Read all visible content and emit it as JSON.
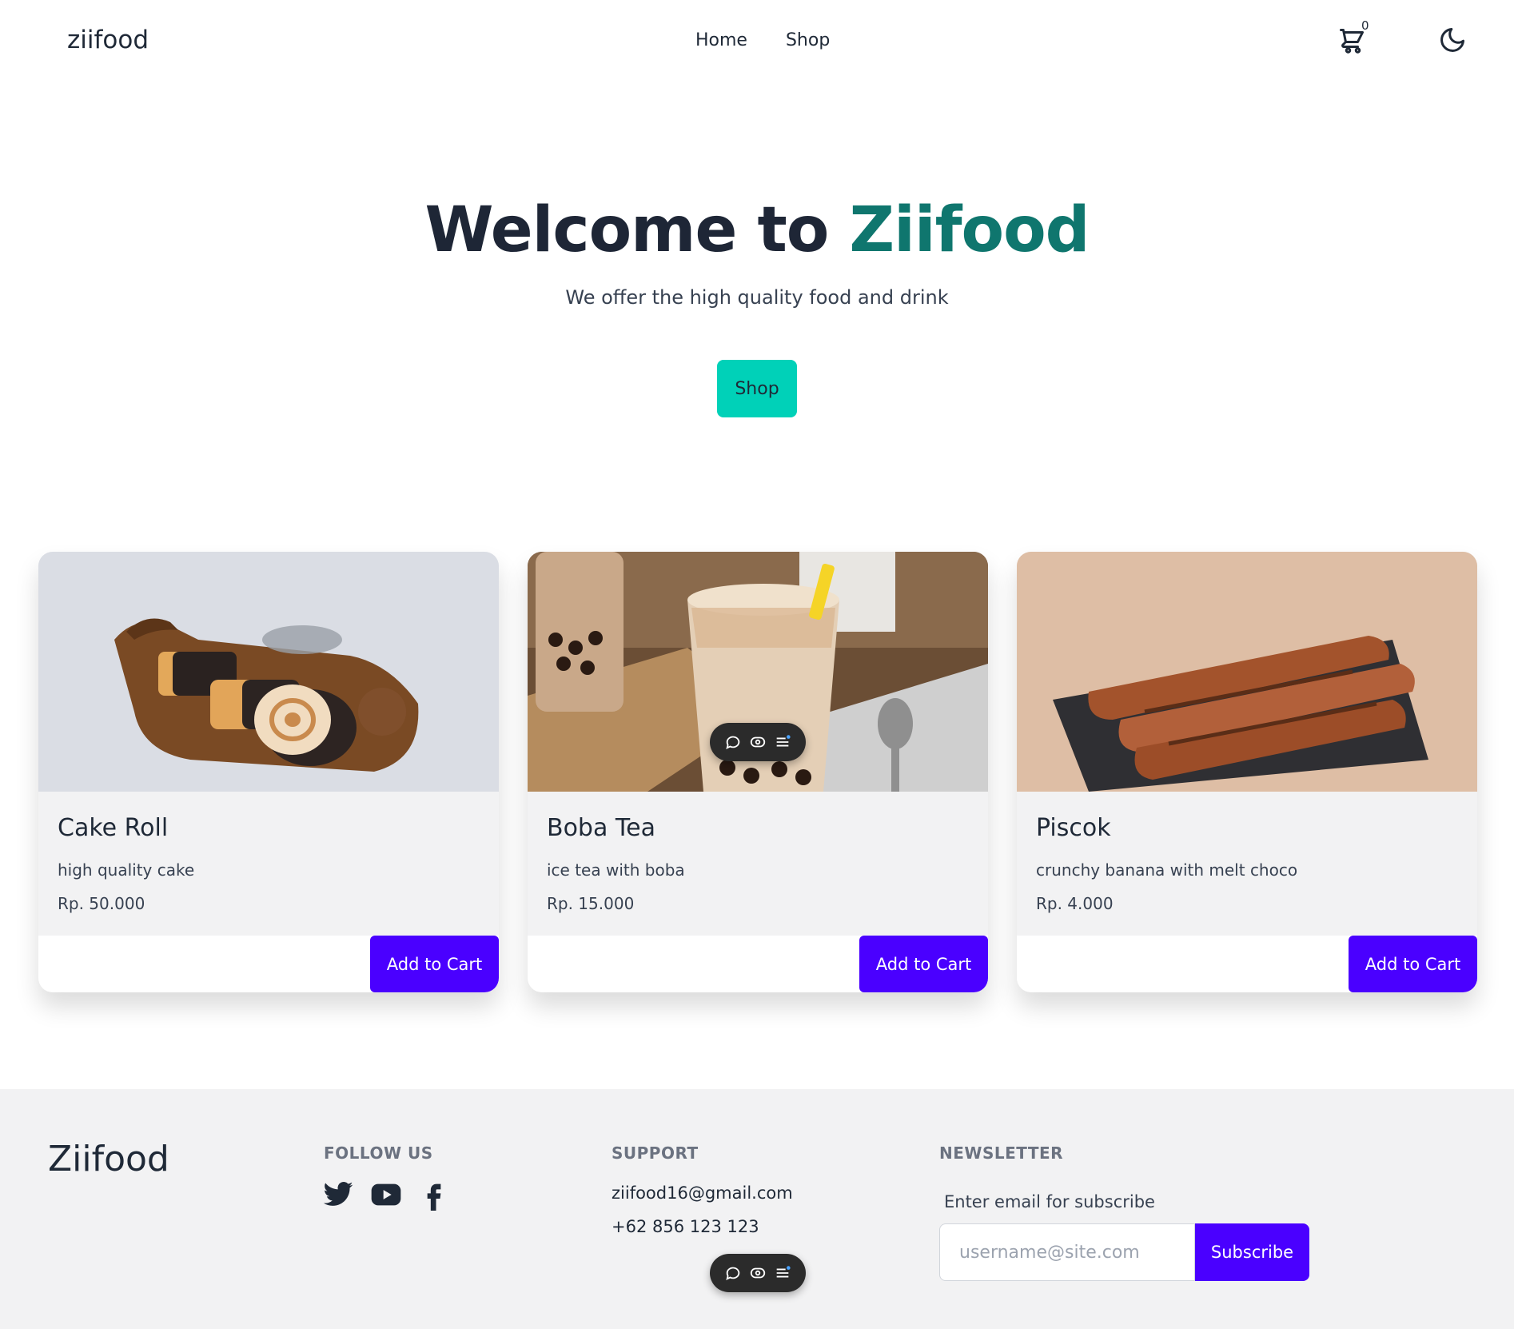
{
  "navbar": {
    "brand": "ziifood",
    "links": [
      "Home",
      "Shop"
    ],
    "cart_count": "0",
    "icons": {
      "cart": "cart-icon",
      "theme": "moon-icon"
    }
  },
  "hero": {
    "title_prefix": "Welcome to",
    "title_accent": "Ziifood",
    "subtitle": "We offer the high quality food and drink",
    "button_label": "Shop"
  },
  "products": [
    {
      "name": "Cake Roll",
      "description": "high quality cake",
      "price": "Rp. 50.000",
      "button_label": "Add to Cart"
    },
    {
      "name": "Boba Tea",
      "description": "ice tea with boba",
      "price": "Rp. 15.000",
      "button_label": "Add to Cart"
    },
    {
      "name": "Piscok",
      "description": "crunchy banana with melt choco",
      "price": "Rp. 4.000",
      "button_label": "Add to Cart"
    }
  ],
  "footer": {
    "brand": "Ziifood",
    "follow_heading": "FOLLOW US",
    "social_icons": [
      "twitter-icon",
      "youtube-icon",
      "facebook-icon"
    ],
    "support_heading": "SUPPORT",
    "support_email": "ziifood16@gmail.com",
    "support_phone": "+62 856 123 123",
    "newsletter_heading": "NEWSLETTER",
    "newsletter_label": "Enter email for subscribe",
    "email_placeholder": "username@site.com",
    "subscribe_label": "Subscribe"
  },
  "colors": {
    "accent": "#0f766e",
    "hero_button": "#00d1b8",
    "primary_button": "#4a00ff",
    "footer_bg": "#f2f2f3"
  }
}
